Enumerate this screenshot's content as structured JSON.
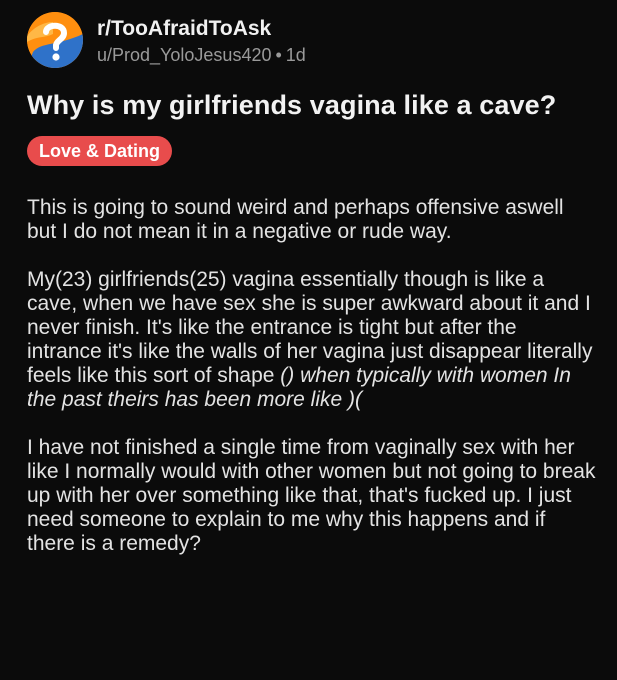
{
  "post": {
    "subreddit": "r/TooAfraidToAsk",
    "author": "u/Prod_YoloJesus420",
    "separator": "•",
    "age": "1d",
    "title": "Why is my girlfriends vagina like a cave?",
    "flair": "Love & Dating",
    "flair_color": "#e84c4c",
    "avatar_icon": "question-mark-icon",
    "body": {
      "p1": "This is going to sound weird and perhaps offensive aswell but I do not mean it in a negative or rude way.",
      "p2_plain": "My(23) girlfriends(25) vagina essentially though is like a cave, when we have sex she is super awkward about it and I never finish. It's like the entrance is tight but after the intrance it's like the walls of her vagina just disappear literally feels like this sort of shape ",
      "p2_italic": "() when typically with women In the past theirs has been more like )(",
      "p3": "I have not finished a single time from vaginally sex with her like I normally would with other women but not going to break up with her over something like that, that's fucked up. I just need someone to explain to me why this happens and if there is a remedy?"
    }
  }
}
